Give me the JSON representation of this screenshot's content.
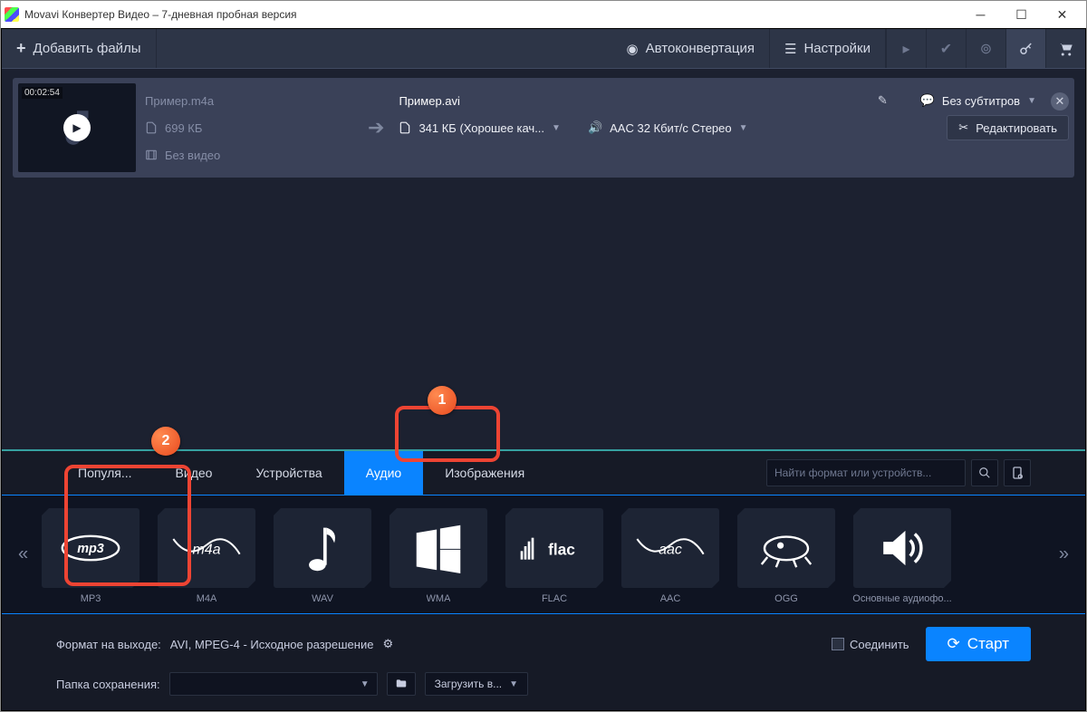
{
  "window": {
    "title": "Movavi Конвертер Видео – 7-дневная пробная версия"
  },
  "toolbar": {
    "add_files": "Добавить файлы",
    "auto_convert": "Автоконвертация",
    "settings": "Настройки"
  },
  "file_item": {
    "duration": "00:02:54",
    "source_name": "Пример.m4a",
    "source_size": "699 КБ",
    "no_video": "Без видео",
    "target_name": "Пример.avi",
    "target_size_quality": "341 КБ (Хорошее кач...",
    "subtitles": "Без субтитров",
    "audio_spec": "AAC 32 Кбит/с Стерео",
    "edit": "Редактировать"
  },
  "tabs": [
    "Популя...",
    "Видео",
    "Устройства",
    "Аудио",
    "Изображения"
  ],
  "active_tab": "Аудио",
  "search": {
    "placeholder": "Найти формат или устройств..."
  },
  "tiles": [
    {
      "label": "MP3",
      "icon": "mp3"
    },
    {
      "label": "M4A",
      "icon": "m4a"
    },
    {
      "label": "WAV",
      "icon": "note"
    },
    {
      "label": "WMA",
      "icon": "windows"
    },
    {
      "label": "FLAC",
      "icon": "flac"
    },
    {
      "label": "AAC",
      "icon": "aac"
    },
    {
      "label": "OGG",
      "icon": "ogg"
    },
    {
      "label": "Основные аудиофо...",
      "icon": "speaker"
    }
  ],
  "bottom": {
    "output_format_label": "Формат на выходе:",
    "output_format_value": "AVI, MPEG-4 - Исходное разрешение",
    "save_folder_label": "Папка сохранения:",
    "load_into": "Загрузить в...",
    "merge": "Соединить",
    "start": "Старт"
  },
  "annotations": {
    "badge1": "1",
    "badge2": "2"
  }
}
